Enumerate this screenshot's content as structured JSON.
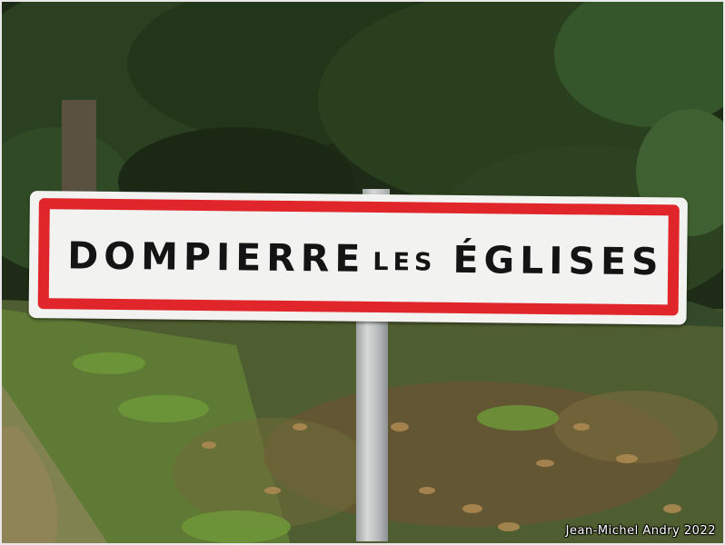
{
  "sign": {
    "word1": "DOMPIERRE",
    "word2": "LES",
    "word3": "ÉGLISES"
  },
  "credit": "Jean-Michel Andry 2022",
  "colors": {
    "sign_border": "#e0262a",
    "sign_background": "#f2f2f0",
    "sign_text": "#141414",
    "foliage_dark": "#1f2e18",
    "grass": "#4d6a2a",
    "leaf_litter": "#8a6a3a"
  }
}
